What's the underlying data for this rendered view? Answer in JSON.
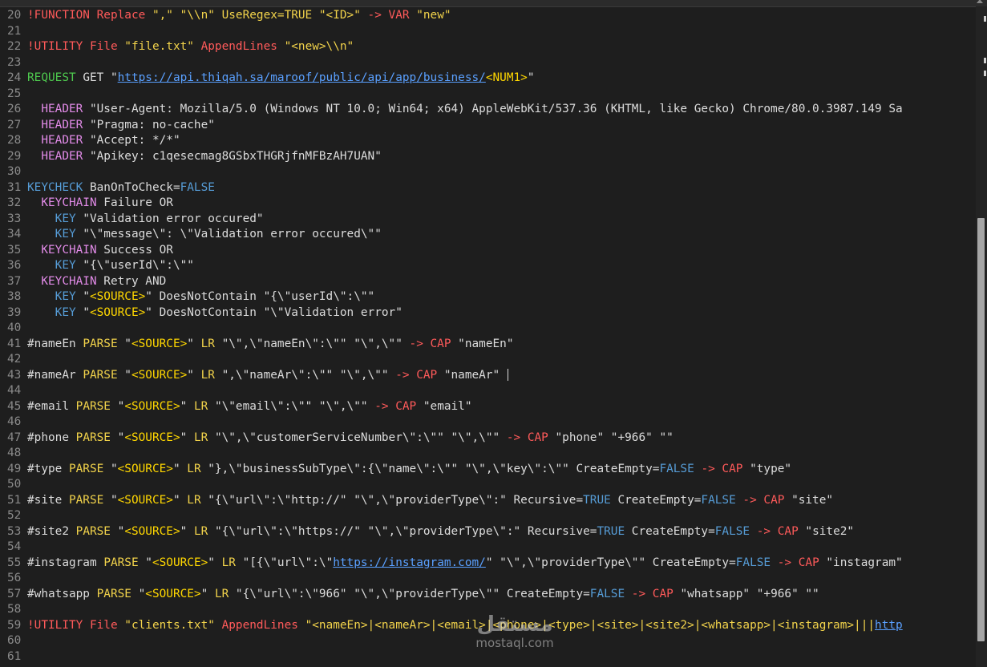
{
  "editor": {
    "lines": [
      {
        "n": "20",
        "s": [
          [
            "c-red",
            "!FUNCTION Replace "
          ],
          [
            "c-yellow",
            "\",\" \"\\\\n\" UseRegex=TRUE \"<ID>\""
          ],
          [
            "c-default",
            " "
          ],
          [
            "c-red",
            "-> VAR "
          ],
          [
            "c-yellow",
            "\"new\""
          ]
        ]
      },
      {
        "n": "21",
        "s": []
      },
      {
        "n": "22",
        "s": [
          [
            "c-red",
            "!UTILITY File "
          ],
          [
            "c-yellow",
            "\"file.txt\""
          ],
          [
            "c-red",
            " AppendLines "
          ],
          [
            "c-yellow",
            "\"<new>\\\\n\""
          ]
        ]
      },
      {
        "n": "23",
        "s": []
      },
      {
        "n": "24",
        "s": [
          [
            "c-green",
            "REQUEST"
          ],
          [
            "c-default",
            " GET \""
          ],
          [
            "c-link",
            "https://api.thiqah.sa/maroof/public/api/app/business/"
          ],
          [
            "c-tag",
            "<NUM1>"
          ],
          [
            "c-default",
            "\""
          ]
        ]
      },
      {
        "n": "25",
        "s": []
      },
      {
        "n": "26",
        "s": [
          [
            "c-default",
            "  "
          ],
          [
            "c-pink",
            "HEADER"
          ],
          [
            "c-default",
            " \"User-Agent: Mozilla/5.0 (Windows NT 10.0; Win64; x64) AppleWebKit/537.36 (KHTML, like Gecko) Chrome/80.0.3987.149 Sa"
          ]
        ]
      },
      {
        "n": "27",
        "s": [
          [
            "c-default",
            "  "
          ],
          [
            "c-pink",
            "HEADER"
          ],
          [
            "c-default",
            " \"Pragma: no-cache\""
          ]
        ]
      },
      {
        "n": "28",
        "s": [
          [
            "c-default",
            "  "
          ],
          [
            "c-pink",
            "HEADER"
          ],
          [
            "c-default",
            " \"Accept: */*\""
          ]
        ]
      },
      {
        "n": "29",
        "s": [
          [
            "c-default",
            "  "
          ],
          [
            "c-pink",
            "HEADER"
          ],
          [
            "c-default",
            " \"Apikey: c1qesecmag8GSbxTHGRjfnMFBzAH7UAN\""
          ]
        ]
      },
      {
        "n": "30",
        "s": []
      },
      {
        "n": "31",
        "s": [
          [
            "c-blue",
            "KEYCHECK"
          ],
          [
            "c-default",
            " BanOnToCheck="
          ],
          [
            "c-blue",
            "FALSE"
          ]
        ]
      },
      {
        "n": "32",
        "s": [
          [
            "c-default",
            "  "
          ],
          [
            "c-pink",
            "KEYCHAIN"
          ],
          [
            "c-default",
            " Failure OR"
          ]
        ]
      },
      {
        "n": "33",
        "s": [
          [
            "c-default",
            "    "
          ],
          [
            "c-blue",
            "KEY"
          ],
          [
            "c-default",
            " \"Validation error occured\""
          ]
        ]
      },
      {
        "n": "34",
        "s": [
          [
            "c-default",
            "    "
          ],
          [
            "c-blue",
            "KEY"
          ],
          [
            "c-default",
            " \"\\\"message\\\": \\\"Validation error occured\\\"\""
          ]
        ]
      },
      {
        "n": "35",
        "s": [
          [
            "c-default",
            "  "
          ],
          [
            "c-pink",
            "KEYCHAIN"
          ],
          [
            "c-default",
            " Success OR"
          ]
        ]
      },
      {
        "n": "36",
        "s": [
          [
            "c-default",
            "    "
          ],
          [
            "c-blue",
            "KEY"
          ],
          [
            "c-default",
            " \"{\\\"userId\\\":\\\"\""
          ]
        ]
      },
      {
        "n": "37",
        "s": [
          [
            "c-default",
            "  "
          ],
          [
            "c-pink",
            "KEYCHAIN"
          ],
          [
            "c-default",
            " Retry AND"
          ]
        ]
      },
      {
        "n": "38",
        "s": [
          [
            "c-default",
            "    "
          ],
          [
            "c-blue",
            "KEY"
          ],
          [
            "c-default",
            " \""
          ],
          [
            "c-tag",
            "<SOURCE>"
          ],
          [
            "c-default",
            "\" DoesNotContain \"{\\\"userId\\\":\\\"\""
          ]
        ]
      },
      {
        "n": "39",
        "s": [
          [
            "c-default",
            "    "
          ],
          [
            "c-blue",
            "KEY"
          ],
          [
            "c-default",
            " \""
          ],
          [
            "c-tag",
            "<SOURCE>"
          ],
          [
            "c-default",
            "\" DoesNotContain \"\\\"Validation error\""
          ]
        ]
      },
      {
        "n": "40",
        "s": []
      },
      {
        "n": "41",
        "s": [
          [
            "c-default",
            "#nameEn "
          ],
          [
            "c-yellow",
            "PARSE"
          ],
          [
            "c-default",
            " \""
          ],
          [
            "c-tag",
            "<SOURCE>"
          ],
          [
            "c-default",
            "\" "
          ],
          [
            "c-yellow",
            "LR"
          ],
          [
            "c-default",
            " \"\\\",\\\"nameEn\\\":\\\"\" \"\\\",\\\"\" "
          ],
          [
            "c-red",
            "-> CAP"
          ],
          [
            "c-default",
            " \"nameEn\""
          ]
        ]
      },
      {
        "n": "42",
        "s": []
      },
      {
        "n": "43",
        "s": [
          [
            "c-default",
            "#nameAr "
          ],
          [
            "c-yellow",
            "PARSE"
          ],
          [
            "c-default",
            " \""
          ],
          [
            "c-tag",
            "<SOURCE>"
          ],
          [
            "c-default",
            "\" "
          ],
          [
            "c-yellow",
            "LR"
          ],
          [
            "c-default",
            " \",\\\"nameAr\\\":\\\"\" \"\\\",\\\"\" "
          ],
          [
            "c-red",
            "-> CAP"
          ],
          [
            "c-default",
            " \"nameAr\" "
          ]
        ],
        "caret": true
      },
      {
        "n": "44",
        "s": []
      },
      {
        "n": "45",
        "s": [
          [
            "c-default",
            "#email "
          ],
          [
            "c-yellow",
            "PARSE"
          ],
          [
            "c-default",
            " \""
          ],
          [
            "c-tag",
            "<SOURCE>"
          ],
          [
            "c-default",
            "\" "
          ],
          [
            "c-yellow",
            "LR"
          ],
          [
            "c-default",
            " \"\\\"email\\\":\\\"\" \"\\\",\\\"\" "
          ],
          [
            "c-red",
            "-> CAP"
          ],
          [
            "c-default",
            " \"email\""
          ]
        ]
      },
      {
        "n": "46",
        "s": []
      },
      {
        "n": "47",
        "s": [
          [
            "c-default",
            "#phone "
          ],
          [
            "c-yellow",
            "PARSE"
          ],
          [
            "c-default",
            " \""
          ],
          [
            "c-tag",
            "<SOURCE>"
          ],
          [
            "c-default",
            "\" "
          ],
          [
            "c-yellow",
            "LR"
          ],
          [
            "c-default",
            " \"\\\",\\\"customerServiceNumber\\\":\\\"\" \"\\\",\\\"\" "
          ],
          [
            "c-red",
            "-> CAP"
          ],
          [
            "c-default",
            " \"phone\" \"+966\" \"\""
          ]
        ]
      },
      {
        "n": "48",
        "s": []
      },
      {
        "n": "49",
        "s": [
          [
            "c-default",
            "#type "
          ],
          [
            "c-yellow",
            "PARSE"
          ],
          [
            "c-default",
            " \""
          ],
          [
            "c-tag",
            "<SOURCE>"
          ],
          [
            "c-default",
            "\" "
          ],
          [
            "c-yellow",
            "LR"
          ],
          [
            "c-default",
            " \"},\\\"businessSubType\\\":{\\\"name\\\":\\\"\" \"\\\",\\\"key\\\":\\\"\" CreateEmpty="
          ],
          [
            "c-blue",
            "FALSE"
          ],
          [
            "c-default",
            " "
          ],
          [
            "c-red",
            "-> CAP"
          ],
          [
            "c-default",
            " \"type\""
          ]
        ]
      },
      {
        "n": "50",
        "s": []
      },
      {
        "n": "51",
        "s": [
          [
            "c-default",
            "#site "
          ],
          [
            "c-yellow",
            "PARSE"
          ],
          [
            "c-default",
            " \""
          ],
          [
            "c-tag",
            "<SOURCE>"
          ],
          [
            "c-default",
            "\" "
          ],
          [
            "c-yellow",
            "LR"
          ],
          [
            "c-default",
            " \"{\\\"url\\\":\\\"http://\" \"\\\",\\\"providerType\\\":\" Recursive="
          ],
          [
            "c-blue",
            "TRUE"
          ],
          [
            "c-default",
            " CreateEmpty="
          ],
          [
            "c-blue",
            "FALSE"
          ],
          [
            "c-default",
            " "
          ],
          [
            "c-red",
            "-> CAP"
          ],
          [
            "c-default",
            " \"site\""
          ]
        ]
      },
      {
        "n": "52",
        "s": []
      },
      {
        "n": "53",
        "s": [
          [
            "c-default",
            "#site2 "
          ],
          [
            "c-yellow",
            "PARSE"
          ],
          [
            "c-default",
            " \""
          ],
          [
            "c-tag",
            "<SOURCE>"
          ],
          [
            "c-default",
            "\" "
          ],
          [
            "c-yellow",
            "LR"
          ],
          [
            "c-default",
            " \"{\\\"url\\\":\\\"https://\" \"\\\",\\\"providerType\\\":\" Recursive="
          ],
          [
            "c-blue",
            "TRUE"
          ],
          [
            "c-default",
            " CreateEmpty="
          ],
          [
            "c-blue",
            "FALSE"
          ],
          [
            "c-default",
            " "
          ],
          [
            "c-red",
            "-> CAP"
          ],
          [
            "c-default",
            " \"site2\""
          ]
        ]
      },
      {
        "n": "54",
        "s": []
      },
      {
        "n": "55",
        "s": [
          [
            "c-default",
            "#instagram "
          ],
          [
            "c-yellow",
            "PARSE"
          ],
          [
            "c-default",
            " \""
          ],
          [
            "c-tag",
            "<SOURCE>"
          ],
          [
            "c-default",
            "\" "
          ],
          [
            "c-yellow",
            "LR"
          ],
          [
            "c-default",
            " \"[{\\\"url\\\":\\\""
          ],
          [
            "c-link",
            "https://instagram.com/"
          ],
          [
            "c-default",
            "\" \"\\\",\\\"providerType\\\"\" CreateEmpty="
          ],
          [
            "c-blue",
            "FALSE"
          ],
          [
            "c-default",
            " "
          ],
          [
            "c-red",
            "-> CAP"
          ],
          [
            "c-default",
            " \"instagram\""
          ]
        ]
      },
      {
        "n": "56",
        "s": []
      },
      {
        "n": "57",
        "s": [
          [
            "c-default",
            "#whatsapp "
          ],
          [
            "c-yellow",
            "PARSE"
          ],
          [
            "c-default",
            " \""
          ],
          [
            "c-tag",
            "<SOURCE>"
          ],
          [
            "c-default",
            "\" "
          ],
          [
            "c-yellow",
            "LR"
          ],
          [
            "c-default",
            " \"{\\\"url\\\":\\\"966\" \"\\\",\\\"providerType\\\"\" CreateEmpty="
          ],
          [
            "c-blue",
            "FALSE"
          ],
          [
            "c-default",
            " "
          ],
          [
            "c-red",
            "-> CAP"
          ],
          [
            "c-default",
            " \"whatsapp\" \"+966\" \"\""
          ]
        ]
      },
      {
        "n": "58",
        "s": []
      },
      {
        "n": "59",
        "s": [
          [
            "c-red",
            "!UTILITY File "
          ],
          [
            "c-yellow",
            "\"clients.txt\""
          ],
          [
            "c-red",
            " AppendLines "
          ],
          [
            "c-yellow",
            "\"<nameEn>|<nameAr>|<email>|<phone>|<type>|<site>|<site2>|<whatsapp>|<instagram>|||"
          ],
          [
            "c-link",
            "http"
          ]
        ]
      },
      {
        "n": "60",
        "s": []
      },
      {
        "n": "61",
        "s": []
      }
    ]
  },
  "watermark": {
    "arabic": "مستقل",
    "latin": "mostaql.com"
  }
}
